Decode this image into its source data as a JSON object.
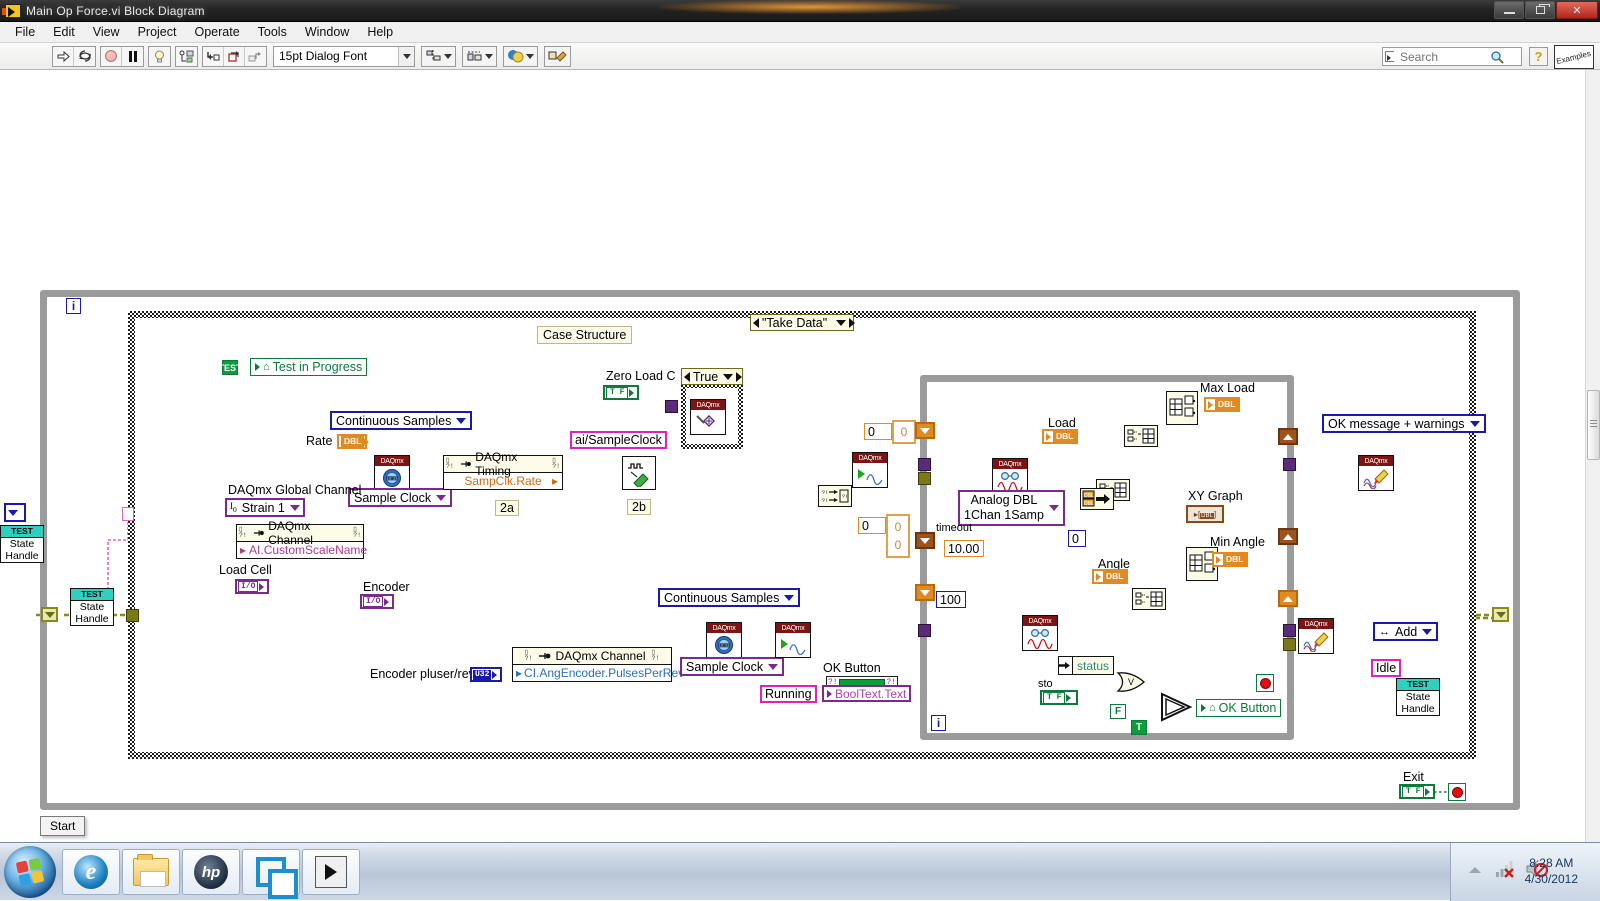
{
  "window": {
    "title": "Main Op Force.vi Block Diagram",
    "icon": "labview-vi-icon",
    "buttons": {
      "minimize": "minimize-button",
      "restore": "restore-button",
      "close": "close-button"
    }
  },
  "menu": {
    "items": [
      "File",
      "Edit",
      "View",
      "Project",
      "Operate",
      "Tools",
      "Window",
      "Help"
    ]
  },
  "toolbar": {
    "run": "run-arrow-icon",
    "run_continuously": "run-continuously-icon",
    "abort": "abort-execution-icon",
    "pause": "pause-icon",
    "highlight": "highlight-execution-bulb-icon",
    "retain_values": "retain-wire-values-icon",
    "step_into": "step-into-icon",
    "step_over": "step-over-icon",
    "step_out": "step-out-icon",
    "font": "15pt Dialog Font",
    "align": "align-objects-icon",
    "distribute": "distribute-objects-icon",
    "reorder": "reorder-icon",
    "clean_up": "clean-up-diagram-icon",
    "search_placeholder": "Search",
    "help": "context-help-icon",
    "examples": "Examples"
  },
  "diagram": {
    "structures": {
      "case_structure_label": "Case Structure",
      "case_selector": "\"Take Data\"",
      "inner_case_selector": "True",
      "outer_iteration": "i",
      "inner_iteration": "i"
    },
    "labels": {
      "test_in_progress": "Test in Progress",
      "rate": "Rate",
      "continuous_samples_1": "Continuous Samples",
      "sample_clock_1": "Sample Clock",
      "daqmx_global_channel": "DAQmx Global Channel",
      "strain_1": "Strain 1",
      "daqmx_channel_1_title": "DAQmx Channel",
      "daqmx_channel_1_prop": "AI.CustomScaleName",
      "load_cell": "Load Cell",
      "encoder": "Encoder",
      "encoder_pulses_per_rev": "Encoder pluser/rev",
      "daqmx_channel_2_title": "DAQmx Channel",
      "daqmx_channel_2_prop": "CI.AngEncoder.PulsesPerRev",
      "continuous_samples_2": "Continuous Samples",
      "sample_clock_2": "Sample Clock",
      "daqmx_timing_title": "DAQmx Timing",
      "daqmx_timing_prop": "SampClk.Rate",
      "ai_sample_clock": "ai/SampleClock",
      "zero_load_cell": "Zero Load C",
      "marker_2a": "2a",
      "marker_2b": "2b",
      "ok_button_label": "OK Button",
      "running": "Running",
      "booltext_text": "BoolText.Text",
      "ok_button_subvi": "OK Button",
      "load": "Load",
      "angle": "Angle",
      "max_load": "Max Load",
      "min_angle": "Min Angle",
      "xy_graph": "XY Graph",
      "analog_dbl": "Analog DBL",
      "analog_dbl_line2": "1Chan 1Samp",
      "timeout": "timeout",
      "timeout_value": "10.00",
      "hundred": "100",
      "zero_a": "0",
      "zero_b": "0",
      "zero_c": "0",
      "zero_d": "0",
      "zero_e": "0",
      "zero_shift": "0",
      "status": "status",
      "sto": "sto",
      "false_const": "F",
      "true_const": "T",
      "or_gate": "V",
      "ok_message_warnings": "OK message + warnings",
      "add": "Add",
      "idle": "Idle",
      "test_tag": "TEST",
      "state": "State",
      "handle": "Handle",
      "exit": "Exit"
    },
    "colors": {
      "error_wire": "#7a7a18",
      "task_wire": "#7a2a8a",
      "dbl_wire": "#e08a22",
      "bool_wire": "#0b7a3b",
      "cluster_wire": "#8a4a18",
      "structure_border": "#9b9b9b"
    }
  },
  "start_button": {
    "label": "Start"
  },
  "taskbar": {
    "start_orb": "windows-start-orb",
    "apps": [
      "internet-explorer-icon",
      "windows-explorer-icon",
      "hp-support-icon",
      "blue-squares-icon",
      "labview-icon"
    ],
    "tray": {
      "show_hidden": "show-hidden-icons-arrow",
      "network": "network-disconnected-icon",
      "volume": "volume-muted-icon"
    },
    "clock": {
      "time": "8:28 AM",
      "date": "4/30/2012"
    }
  }
}
